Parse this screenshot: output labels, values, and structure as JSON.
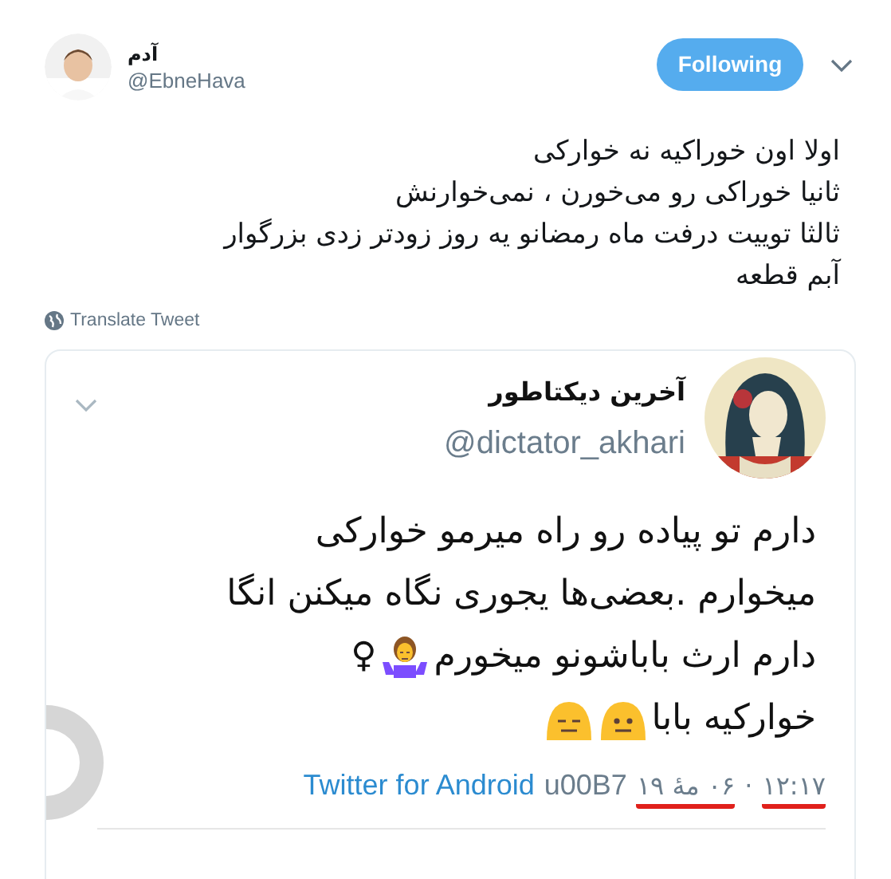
{
  "tweet": {
    "name": "آدم",
    "handle": "@EbneHava",
    "follow_button": "Following",
    "lines": [
      "اولا اون خوراکیه نه خوارکی",
      "ثانیا خوراکی رو می‌خورن ، نمی‌خوارنش",
      "ثالثا توییت درفت ماه رمضانو یه روز زودتر زدی بزرگوار",
      "آبم قطعه"
    ],
    "translate": "Translate Tweet"
  },
  "quoted": {
    "name": "آخرین دیکتاطور",
    "handle": "@dictator_akhari",
    "lines": [
      {
        "text": "دارم تو پیاده رو راه میرمو خوارکی"
      },
      {
        "text": "میخوارم .بعضی‌ها یجوری نگاه میکنن انگا"
      },
      {
        "text": "دارم ارث باباشونو میخورم",
        "emoji": [
          {
            "kind": "shrug"
          }
        ],
        "suffix": "♀"
      },
      {
        "text": "خوارکیه بابا",
        "emoji": [
          {
            "kind": "neutral"
          },
          {
            "kind": "expressionless"
          }
        ]
      }
    ],
    "source": "Twitter for Android",
    "separator": "u00B7",
    "date_parts": [
      {
        "text": "۱۲:۱۷",
        "underlined": true
      },
      {
        "text": "·",
        "underlined": false
      },
      {
        "text": "۰۶ مۀ ۱۹",
        "underlined": true
      }
    ]
  }
}
